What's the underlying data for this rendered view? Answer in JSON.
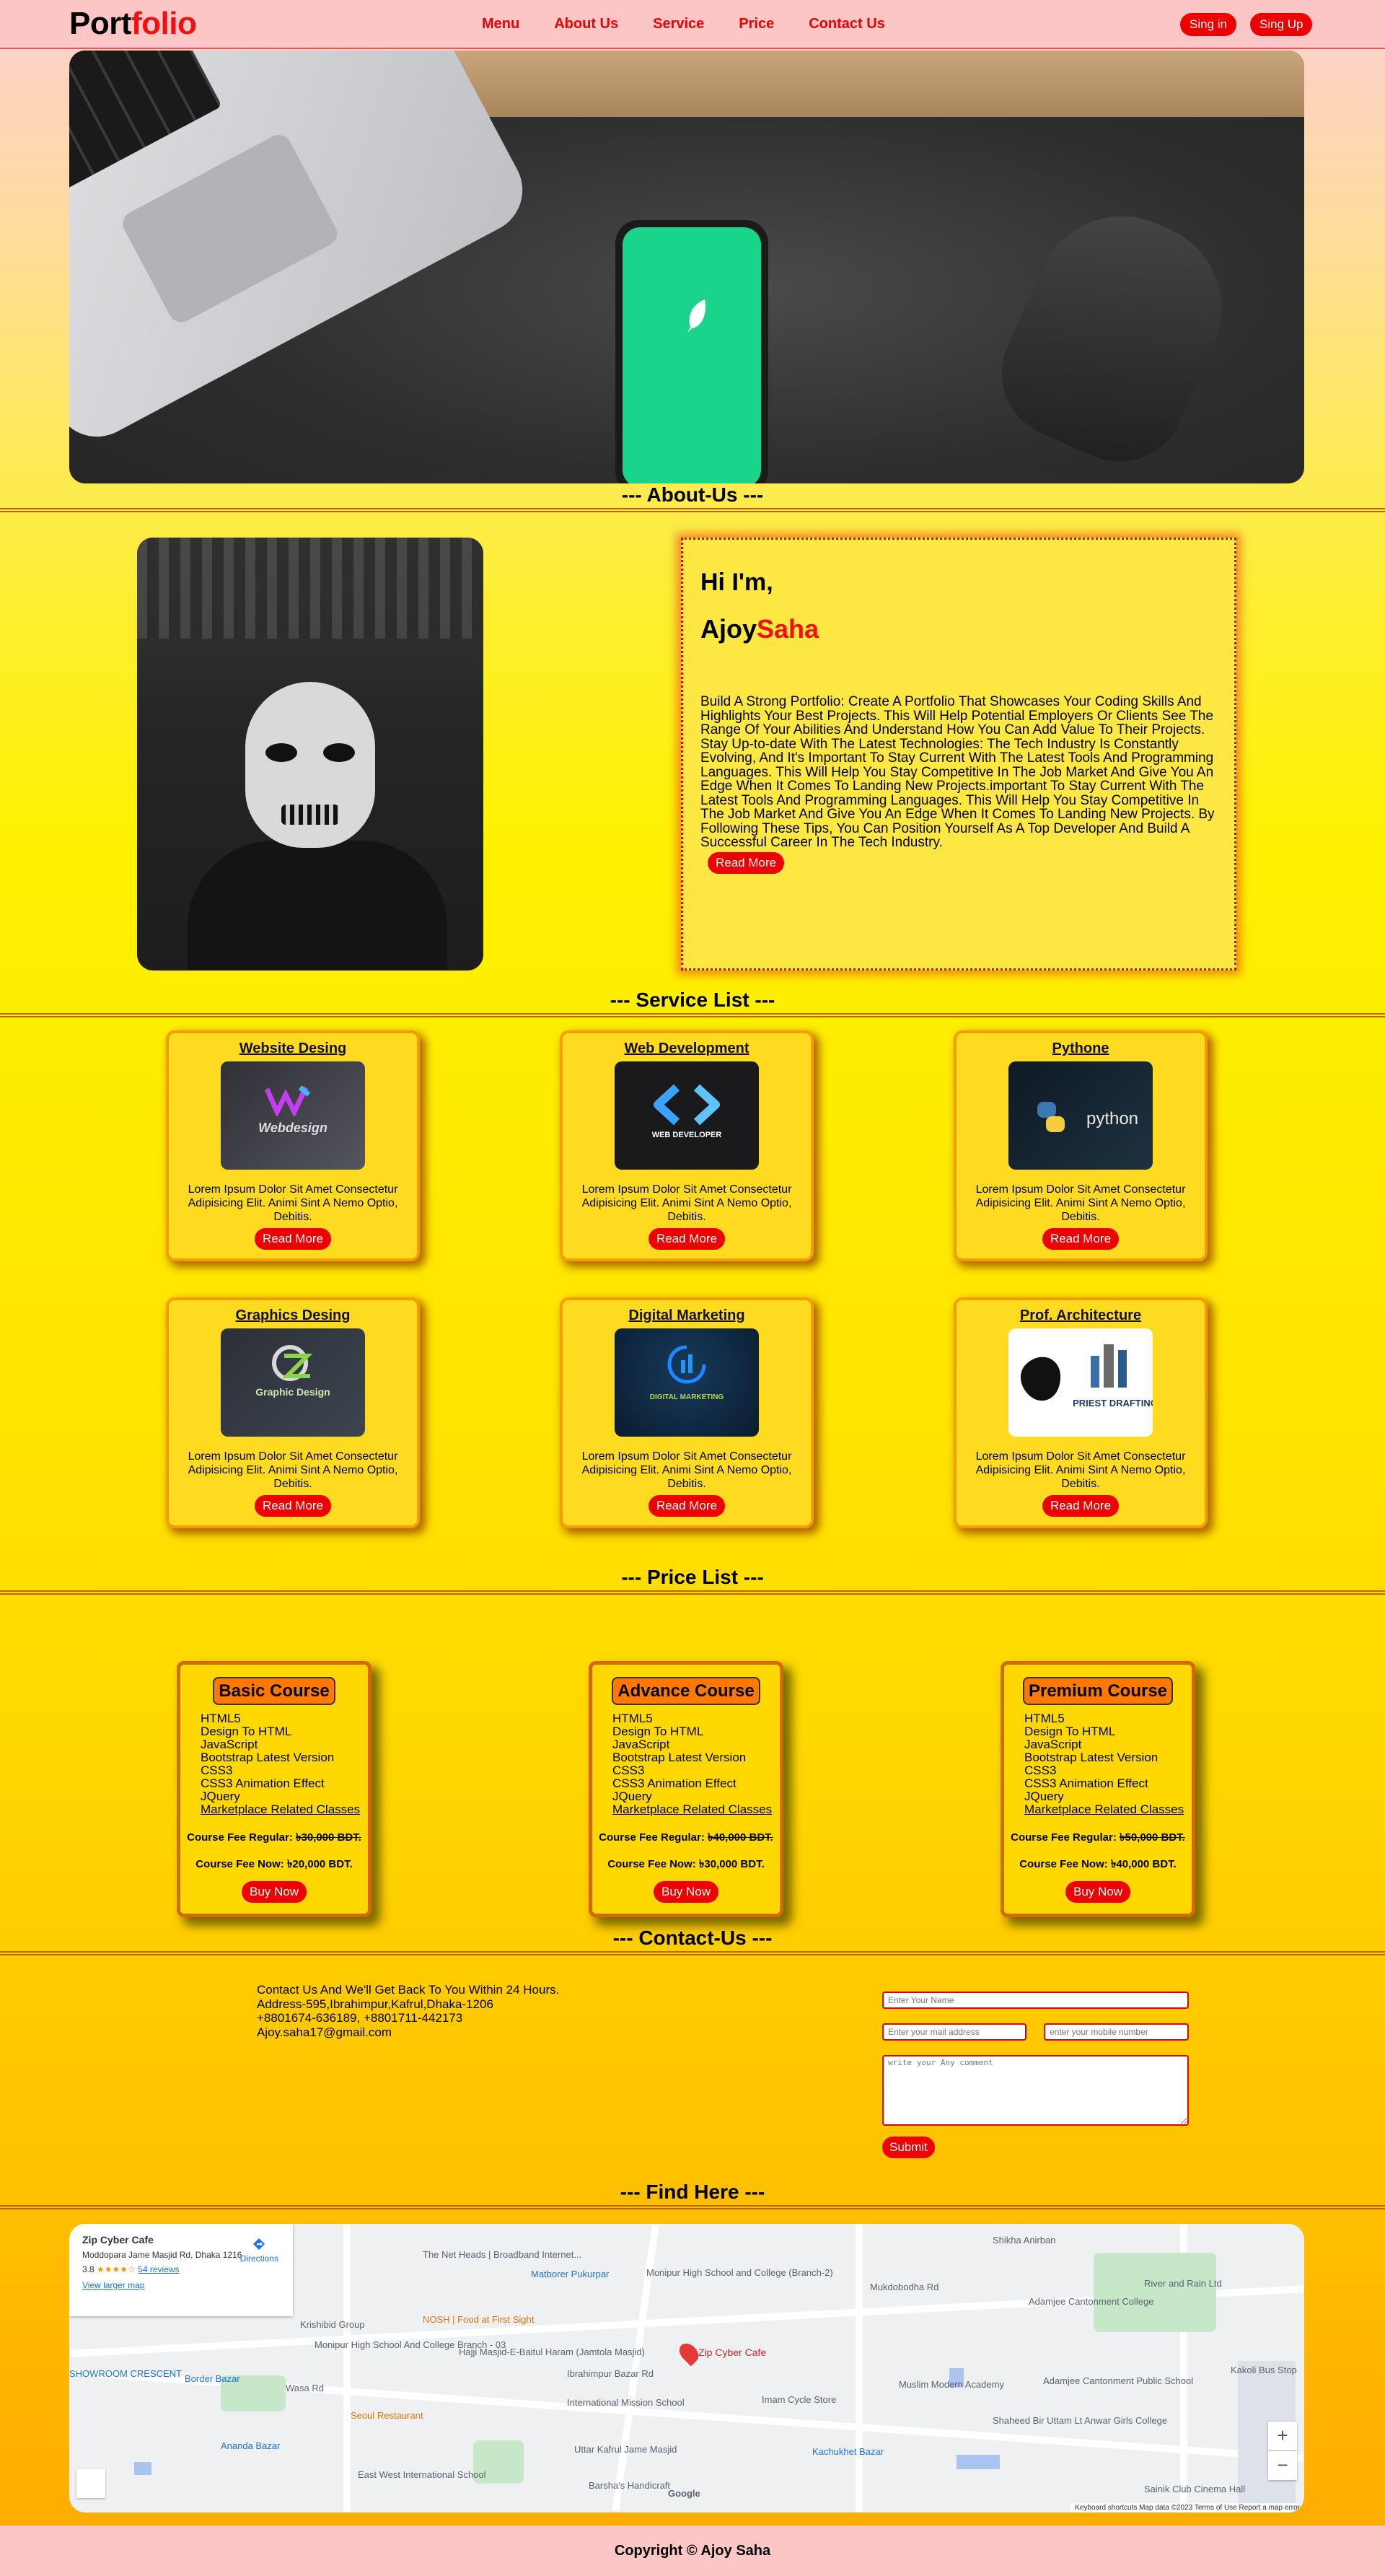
{
  "nav": {
    "logo_part1": "Port",
    "logo_part2": "folio",
    "menu": [
      "Menu",
      "About Us",
      "Service",
      "Price",
      "Contact Us"
    ],
    "signin": "Sing in",
    "signup": "Sing Up"
  },
  "sections": {
    "about": "--- About-Us ---",
    "service": "--- Service List ---",
    "price": "--- Price List ---",
    "contact": "--- Contact-Us ---",
    "find": "--- Find Here ---"
  },
  "about": {
    "greeting": "Hi I'm,",
    "first_name": "Ajoy",
    "last_name": "Saha",
    "bio": "Build A Strong Portfolio: Create A Portfolio That Showcases Your Coding Skills And Highlights Your Best Projects. This Will Help Potential Employers Or Clients See The Range Of Your Abilities And Understand How You Can Add Value To Their Projects. Stay Up-to-date With The Latest Technologies: The Tech Industry Is Constantly Evolving, And It's Important To Stay Current With The Latest Tools And Programming Languages. This Will Help You Stay Competitive In The Job Market And Give You An Edge When It Comes To Landing New Projects.important To Stay Current With The Latest Tools And Programming Languages. This Will Help You Stay Competitive In The Job Market And Give You An Edge When It Comes To Landing New Projects. By Following These Tips, You Can Position Yourself As A Top Developer And Build A Successful Career In The Tech Industry.",
    "button": "Read More"
  },
  "services": [
    {
      "title": "Website Desing",
      "thumb_text": "Webdesign",
      "desc": "Lorem Ipsum Dolor Sit Amet Consectetur Adipisicing Elit. Animi Sint A Nemo Optio, Debitis.",
      "button": "Read More"
    },
    {
      "title": "Web Development",
      "thumb_text": "WEB DEVELOPER",
      "desc": "Lorem Ipsum Dolor Sit Amet Consectetur Adipisicing Elit. Animi Sint A Nemo Optio, Debitis.",
      "button": "Read More"
    },
    {
      "title": "Pythone",
      "thumb_text": "python",
      "desc": "Lorem Ipsum Dolor Sit Amet Consectetur Adipisicing Elit. Animi Sint A Nemo Optio, Debitis.",
      "button": "Read More"
    },
    {
      "title": "Graphics Desing",
      "thumb_text": "Graphic Design",
      "desc": "Lorem Ipsum Dolor Sit Amet Consectetur Adipisicing Elit. Animi Sint A Nemo Optio, Debitis.",
      "button": "Read More"
    },
    {
      "title": "Digital Marketing",
      "thumb_text": "DIGITAL MARKETING",
      "desc": "Lorem Ipsum Dolor Sit Amet Consectetur Adipisicing Elit. Animi Sint A Nemo Optio, Debitis.",
      "button": "Read More"
    },
    {
      "title": "Prof. Architecture",
      "thumb_text": "PRIEST DRAFTING",
      "desc": "Lorem Ipsum Dolor Sit Amet Consectetur Adipisicing Elit. Animi Sint A Nemo Optio, Debitis.",
      "button": "Read More"
    }
  ],
  "prices": [
    {
      "title": "Basic Course",
      "items": [
        "HTML5",
        "Design To HTML",
        "JavaScript",
        "Bootstrap Latest Version",
        "CSS3",
        "CSS3 Animation Effect",
        "JQuery",
        "Marketplace Related Classes"
      ],
      "regular_label": "Course Fee Regular: ",
      "regular": "৳30,000 BDT.",
      "now_label": "Course Fee Now: ",
      "now": "৳20,000 BDT.",
      "button": "Buy Now"
    },
    {
      "title": "Advance Course",
      "items": [
        "HTML5",
        "Design To HTML",
        "JavaScript",
        "Bootstrap Latest Version",
        "CSS3",
        "CSS3 Animation Effect",
        "JQuery",
        "Marketplace Related Classes"
      ],
      "regular_label": "Course Fee Regular: ",
      "regular": "৳40,000 BDT.",
      "now_label": "Course Fee Now: ",
      "now": "৳30,000 BDT.",
      "button": "Buy Now"
    },
    {
      "title": "Premium Course",
      "items": [
        "HTML5",
        "Design To HTML",
        "JavaScript",
        "Bootstrap Latest Version",
        "CSS3",
        "CSS3 Animation Effect",
        "JQuery",
        "Marketplace Related Classes"
      ],
      "regular_label": "Course Fee Regular: ",
      "regular": "৳50,000 BDT.",
      "now_label": "Course Fee Now: ",
      "now": "৳40,000 BDT.",
      "button": "Buy Now"
    }
  ],
  "contact": {
    "line1": "Contact Us And We'll Get Back To You Within 24 Hours.",
    "address": "Address-595,Ibrahimpur,Kafrul,Dhaka-1206",
    "phones": "+8801674-636189, +8801711-442173",
    "email": "Ajoy.saha17@gmail.com",
    "name_placeholder": "Enter Your Name",
    "mail_placeholder": "Enter your mail address",
    "mobile_placeholder": "enter your mobile number",
    "comment_placeholder": "write your Any comment",
    "submit": "Submit"
  },
  "map": {
    "place_name": "Zip Cyber Cafe",
    "place_address": "Moddopara Jame Masjid Rd, Dhaka 1216",
    "rating": "3.8",
    "stars": "★★★★☆",
    "reviews": "54 reviews",
    "larger_map": "View larger map",
    "directions": "Directions",
    "pin_label": "Zip Cyber Cafe",
    "labels": [
      "The Net Heads | Broadband Internet...",
      "Matborer Pukurpar",
      "Monipur High School and College (Branch-2)",
      "Mukdobodha Rd",
      "Shikha Anirban",
      "Adamjee Cantonment College",
      "River and Rain Ltd",
      "Kakoli Bus Stop",
      "Krishibid Group",
      "NOSH | Food at First Sight",
      "Hajji Masjid-E-Baitul Haram (Jamtola Masjid)",
      "Ibrahimpur Bazar Rd",
      "Monipur High School And College Branch - 03",
      "Border Bazar",
      "Wasa Rd",
      "Seoul Restaurant",
      "International Mission School",
      "Imam Cycle Store",
      "Muslim Modern Academy",
      "Adamjee Cantonment Public School",
      "Shaheed Bir Uttam Lt Anwar Girls College",
      "Ananda Bazar",
      "East West International School",
      "Uttar Kafrul Jame Masjid",
      "Kachukhet Bazar",
      "Barsha's Handicraft",
      "Sainik Club Cinema Hall",
      "SHOWROOM CRESCENT",
      "Google"
    ],
    "footer": "Keyboard shortcuts   Map data ©2023   Terms of Use   Report a map error"
  },
  "footer": {
    "copyright": "Copyright © Ajoy Saha"
  }
}
